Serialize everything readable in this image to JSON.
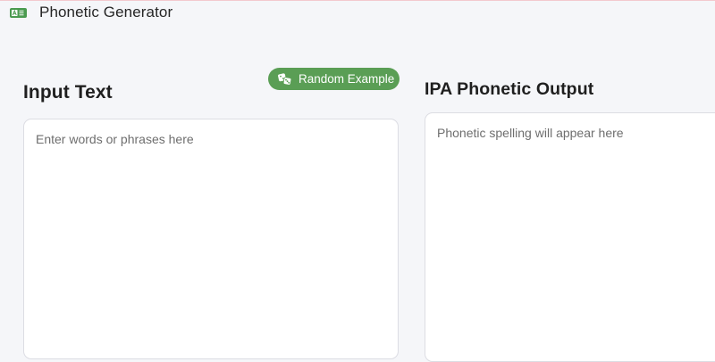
{
  "header": {
    "title": "Phonetic Generator",
    "logo_icon": "translate-badge-icon",
    "logo_color": "#4a9a4f"
  },
  "toolbar": {
    "random_label": "Random Example",
    "random_icon": "dice-icon",
    "button_color": "#5a9e55"
  },
  "input_panel": {
    "heading": "Input Text",
    "placeholder": "Enter words or phrases here",
    "value": ""
  },
  "output_panel": {
    "heading": "IPA Phonetic Output",
    "placeholder": "Phonetic spelling will appear here"
  }
}
